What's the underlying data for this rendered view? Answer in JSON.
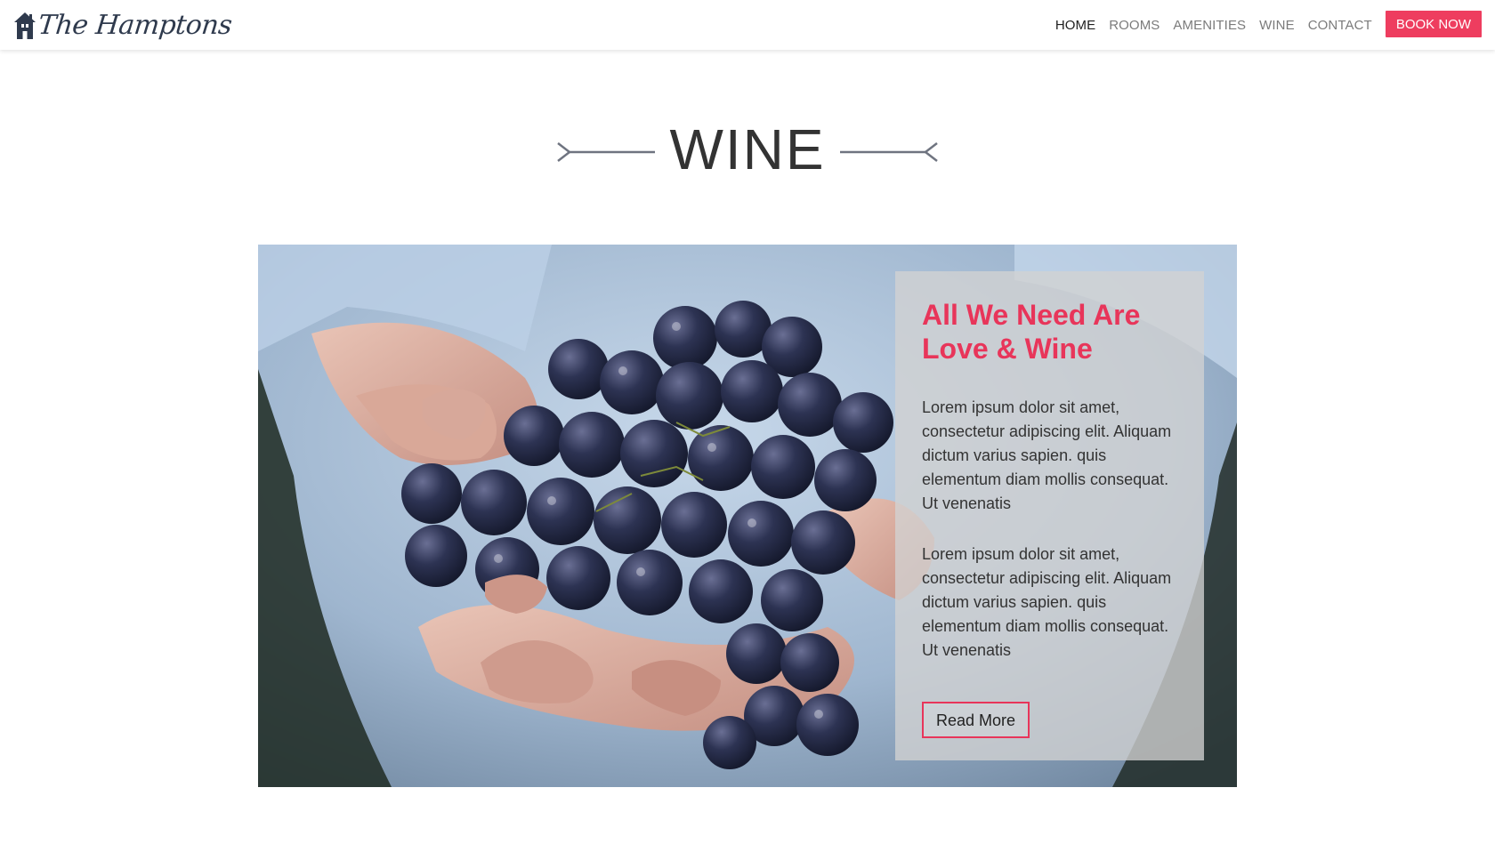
{
  "header": {
    "brand": "The Hamptons",
    "nav": [
      {
        "label": "HOME",
        "active": true
      },
      {
        "label": "ROOMS",
        "active": false
      },
      {
        "label": "AMENITIES",
        "active": false
      },
      {
        "label": "WINE",
        "active": false
      },
      {
        "label": "CONTACT",
        "active": false
      }
    ],
    "book_label": "BOOK NOW"
  },
  "section": {
    "title": "WINE"
  },
  "card": {
    "title": "All We Need Are Love & Wine",
    "paragraphs": [
      "Lorem ipsum dolor sit amet, consectetur adipiscing elit. Aliquam dictum varius sapien. quis elementum diam mollis consequat. Ut venenatis",
      "Lorem ipsum dolor sit amet, consectetur adipiscing elit. Aliquam dictum varius sapien. quis elementum diam mollis consequat. Ut venenatis"
    ],
    "button_label": "Read More"
  },
  "colors": {
    "accent": "#ee3d5f",
    "title_pink": "#e8355a",
    "text_dark": "#333333",
    "nav_gray": "#7b7b7b",
    "arrow_gray": "#6f7480"
  },
  "icons": {
    "logo": "house-icon",
    "title_left": "arrow-left-ornament-icon",
    "title_right": "arrow-right-ornament-icon"
  }
}
